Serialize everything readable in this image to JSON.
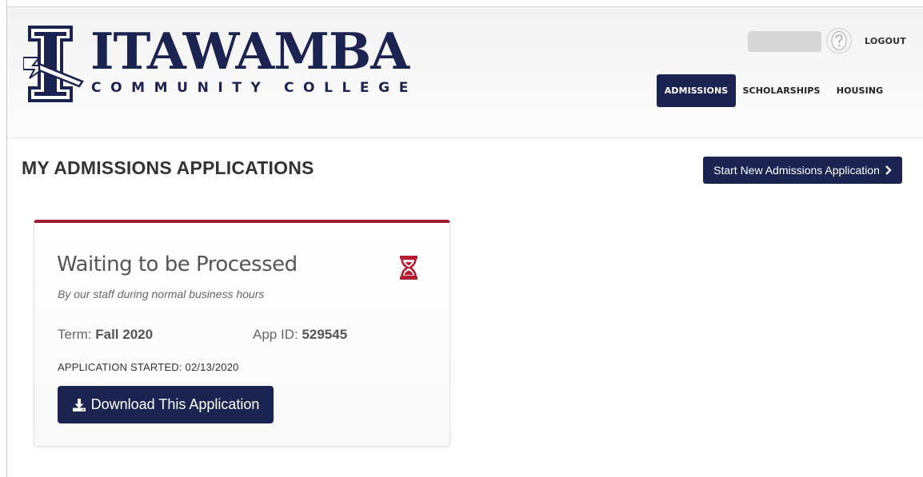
{
  "brand": {
    "name": "ITAWAMBA",
    "subtitle": "COMMUNITY COLLEGE",
    "primary_color": "#1b2350",
    "accent_color": "#9d1b2d",
    "logo_icon": "lightning-i-icon"
  },
  "account": {
    "avatar_icon": "question-avatar-icon",
    "logout_label": "LOGOUT"
  },
  "nav": {
    "items": [
      {
        "label": "ADMISSIONS",
        "active": true
      },
      {
        "label": "SCHOLARSHIPS",
        "active": false
      },
      {
        "label": "HOUSING",
        "active": false
      }
    ]
  },
  "page": {
    "title": "MY ADMISSIONS APPLICATIONS",
    "start_button_label": "Start New Admissions Application",
    "start_button_icon": "chevron-right-icon"
  },
  "application": {
    "status": "Waiting to be Processed",
    "status_detail": "By our staff during normal business hours",
    "status_icon": "hourglass-icon",
    "term_label": "Term:",
    "term_value": "Fall 2020",
    "app_id_label": "App ID:",
    "app_id_value": "529545",
    "started_text": "APPLICATION STARTED: 02/13/2020",
    "download_label": "Download This Application",
    "download_icon": "download-icon"
  }
}
